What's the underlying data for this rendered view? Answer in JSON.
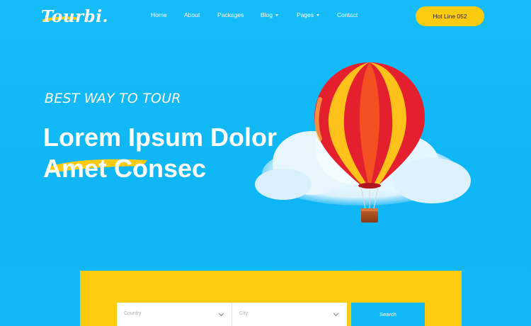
{
  "brand": {
    "logo_text": "Tourbi."
  },
  "nav": {
    "items": [
      {
        "label": "Home"
      },
      {
        "label": "About"
      },
      {
        "label": "Packages"
      },
      {
        "label": "Blog"
      },
      {
        "label": "Pages"
      },
      {
        "label": "Contact"
      }
    ],
    "hotline_label": "Hot Line 052"
  },
  "hero": {
    "tagline": "BEST WAY TO TOUR",
    "headline_line1": "Lorem Ipsum Dolor",
    "headline_line2": "Amet Consec"
  },
  "search": {
    "country_placeholder": "Country",
    "city_placeholder": "City",
    "button_label": "Search"
  },
  "colors": {
    "background": "#10b9f7",
    "accent_yellow": "#ffcb0e",
    "balloon_red": "#e5202e",
    "balloon_yellow": "#ffc21a",
    "text": "#ffffff"
  },
  "icons": [
    "hot-air-balloon-illustration",
    "cloud-illustration",
    "chevron-down-icon",
    "caret-down-icon"
  ]
}
